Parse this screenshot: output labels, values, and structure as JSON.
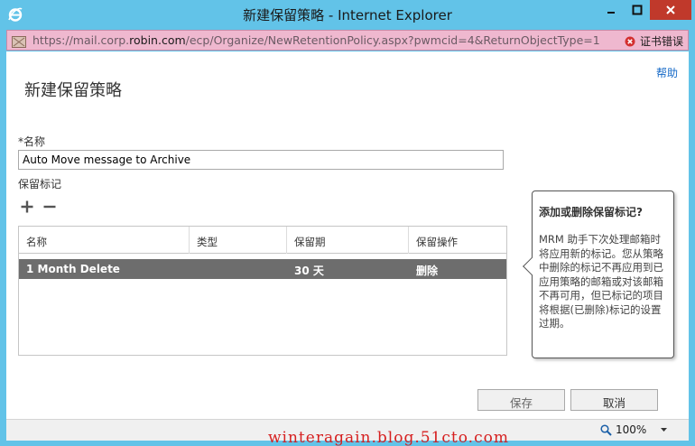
{
  "window": {
    "title": "新建保留策略 - Internet Explorer",
    "icons": [
      "ie-logo-icon",
      "minimize-icon",
      "maximize-icon",
      "close-icon"
    ]
  },
  "address_bar": {
    "url_prefix": "https://mail.corp.",
    "url_host": "robin.com",
    "url_path": "/ecp/Organize/NewRetentionPolicy.aspx?pwmcid=4&ReturnObjectType=1",
    "cert_error": "证书错误",
    "bg_color": "#efb8cf"
  },
  "page": {
    "help": "帮助",
    "title": "新建保留策略",
    "name_label": "*名称",
    "name_value": "Auto Move message to Archive",
    "tags_label": "保留标记"
  },
  "grid": {
    "columns": [
      "名称",
      "类型",
      "保留期",
      "保留操作"
    ],
    "rows": [
      {
        "name": "1 Month Delete",
        "type": "",
        "period": "30 天",
        "action": "删除"
      }
    ]
  },
  "callout": {
    "title": "添加或删除保留标记?",
    "body": "MRM 助手下次处理邮箱时将应用新的标记。您从策略中删除的标记不再应用到已应用策略的邮箱或对该邮箱不再可用，但已标记的项目将根据(已删除)标记的设置过期。"
  },
  "buttons": {
    "save": "保存",
    "cancel": "取消"
  },
  "status": {
    "zoom": "100%"
  },
  "watermark": "winteragain.blog.51cto.com",
  "colors": {
    "chrome": "#62c3e8",
    "close": "#c0392b",
    "selected_row": "#6d6d6d",
    "link": "#1569c7"
  }
}
